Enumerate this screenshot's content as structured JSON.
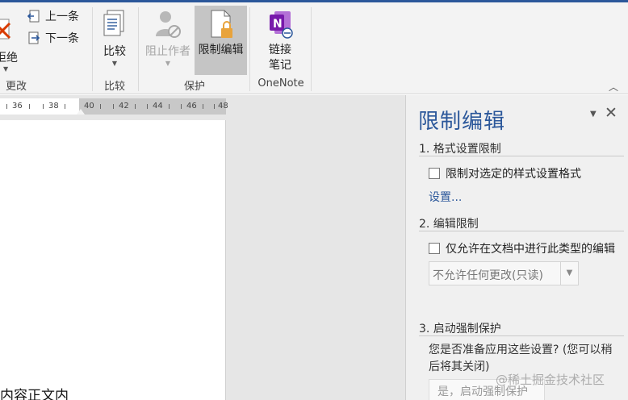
{
  "ribbon": {
    "changes_group": {
      "reject_label": "拒绝",
      "previous_label": "上一条",
      "next_label": "下一条",
      "group_label": "更改"
    },
    "compare_group": {
      "compare_label": "比较",
      "group_label": "比较"
    },
    "protect_group": {
      "block_authors_label": "阻止作者",
      "restrict_editing_label": "限制编辑",
      "group_label": "保护"
    },
    "onenote_group": {
      "linked_notes_label_line1": "链接",
      "linked_notes_label_line2": "笔记",
      "group_label": "OneNote"
    }
  },
  "ruler": {
    "labels": [
      "36",
      "38",
      "40",
      "42",
      "44",
      "46",
      "48"
    ]
  },
  "document": {
    "visible_text": "内容正文内"
  },
  "pane": {
    "title": "限制编辑",
    "section1": {
      "title": "1. 格式设置限制",
      "checkbox_label": "限制对选定的样式设置格式",
      "settings_link": "设置..."
    },
    "section2": {
      "title": "2. 编辑限制",
      "checkbox_label": "仅允许在文档中进行此类型的编辑",
      "select_value": "不允许任何更改(只读)"
    },
    "section3": {
      "title": "3. 启动强制保护",
      "description_line1": "您是否准备应用这些设置? (您可以稍",
      "description_line2": "后将其关闭)",
      "start_button_label": "是，启动强制保护"
    }
  },
  "watermark": "@稀土掘金技术社区",
  "colors": {
    "accent": "#2b579a",
    "onenote": "#7719aa",
    "ribbon_bg": "#f3f3f3",
    "pane_bg": "#f0f0f0"
  }
}
